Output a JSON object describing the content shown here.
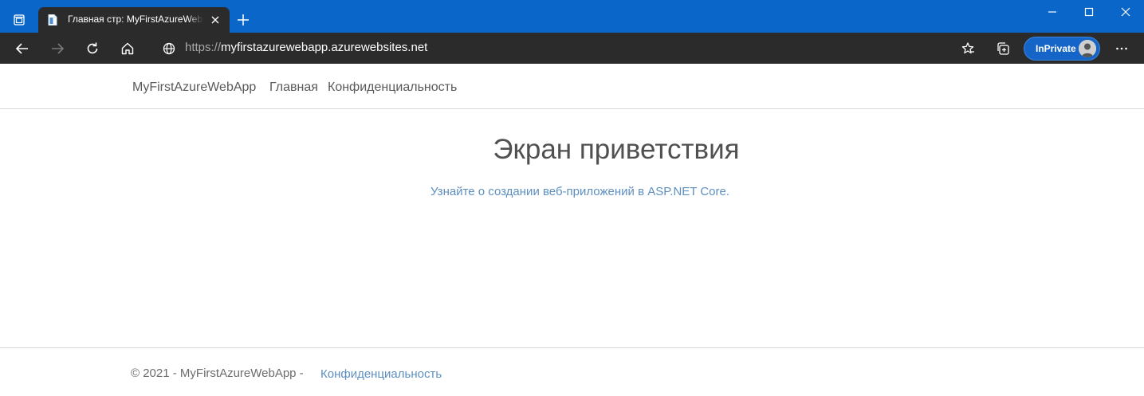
{
  "browser": {
    "tab": {
      "title_prefix": "Главная стр: ",
      "title_site": "MyFirstAzureWebApp"
    },
    "address": {
      "scheme": "https://",
      "host": "myfirstazurewebapp.azurewebsites.net"
    },
    "inprivate_label": "InPrivate",
    "colors": {
      "tabstrip": "#0a66c9",
      "toolbar": "#2b2b2b",
      "inprivate": "#1565c8"
    },
    "icons": [
      "tab-actions-icon",
      "page-favicon-icon",
      "close-icon",
      "plus-icon",
      "minimize-icon",
      "maximize-icon",
      "window-close-icon",
      "back-arrow-icon",
      "forward-arrow-icon",
      "refresh-icon",
      "home-icon",
      "globe-icon",
      "favorites-star-icon",
      "collections-icon",
      "avatar-icon",
      "more-icon"
    ]
  },
  "site": {
    "nav": {
      "brand": "MyFirstAzureWebApp",
      "links": [
        {
          "label": "Главная"
        },
        {
          "label": "Конфиденциальность"
        }
      ]
    },
    "hero": {
      "title": "Экран приветствия",
      "link_text": "Узнайте о создании веб-приложений в ASP.NET Core."
    },
    "footer": {
      "copyright": "© 2021 - MyFirstAzureWebApp -",
      "privacy_link": "Конфиденциальность"
    },
    "colors": {
      "link": "#5e8fc0",
      "text": "#5a5a5a"
    }
  }
}
